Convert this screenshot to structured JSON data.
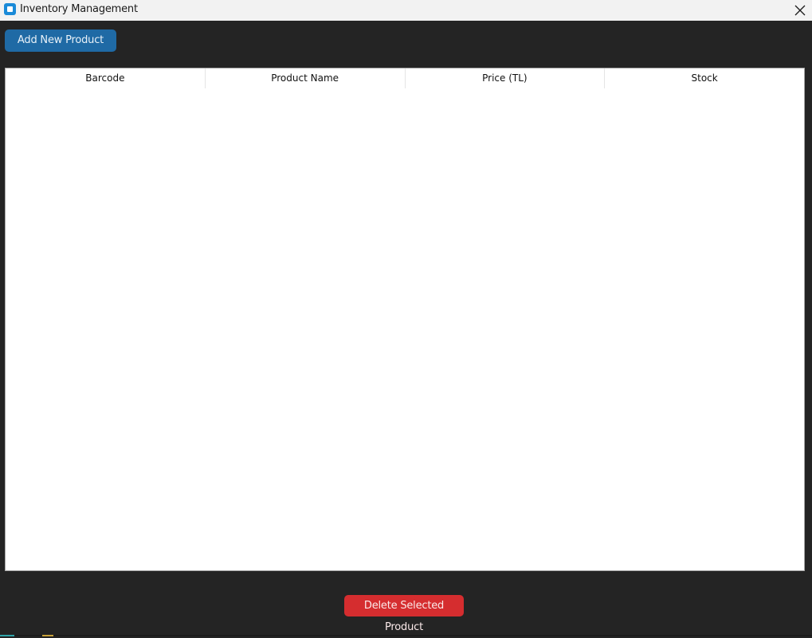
{
  "window": {
    "title": "Inventory Management",
    "icon": "app-window-icon",
    "close_icon": "close-icon"
  },
  "toolbar": {
    "add_label": "Add New Product"
  },
  "table": {
    "columns": [
      "Barcode",
      "Product Name",
      "Price (TL)",
      "Stock"
    ],
    "rows": []
  },
  "actions": {
    "delete_label": "Delete Selected Product"
  },
  "colors": {
    "background": "#242424",
    "titlebar": "#f2f2f2",
    "add_button": "#1f6aa5",
    "delete_button": "#d52d2f",
    "table_bg": "#ffffff"
  }
}
